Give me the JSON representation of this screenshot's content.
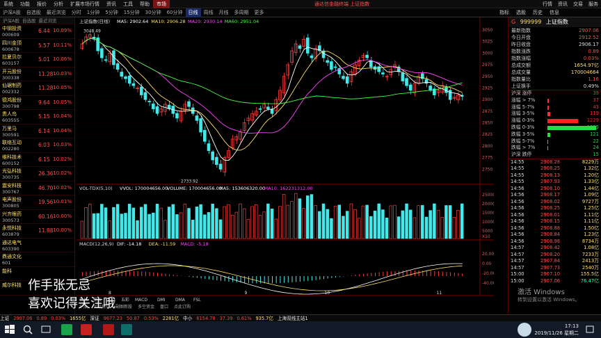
{
  "menu": [
    "系统",
    "功能",
    "报价",
    "分析",
    "扩展市场行情",
    "资讯",
    "工具",
    "帮助"
  ],
  "menu_market": "市场",
  "broker_title": "通达信金融终端  上证指数",
  "top_right": [
    "行情",
    "资讯",
    "交易",
    "服务"
  ],
  "toolbar": [
    "沪深A股",
    "自选股",
    "最近浏览",
    "分时",
    "1分钟",
    "5分钟",
    "15分钟",
    "30分钟",
    "60分钟",
    "日线",
    "周线",
    "月线",
    "多周期",
    "更多"
  ],
  "toolbar_right": [
    "指标",
    "选股",
    "历史",
    "信息"
  ],
  "list_headers": [
    "沪深A股",
    "自选股",
    "最近浏览"
  ],
  "stocks": [
    {
      "name": "中钢投资",
      "code": "000609",
      "price": "6.44",
      "pct": "10.09%"
    },
    {
      "name": "四川金顶",
      "code": "600678",
      "price": "5.57",
      "pct": "10.11%"
    },
    {
      "name": "拉夏贝尔",
      "code": "603157",
      "price": "5.01",
      "pct": "10.06%"
    },
    {
      "name": "开元股份",
      "code": "300338",
      "price": "11.28",
      "pct": "10.03%"
    },
    {
      "name": "仙琚制药",
      "code": "002332",
      "price": "11.28",
      "pct": "10.05%"
    },
    {
      "name": "德鸿股份",
      "code": "300798",
      "price": "9.64",
      "pct": "10.05%"
    },
    {
      "name": "贵人鸟",
      "code": "603555",
      "price": "5.15",
      "pct": "10.04%"
    },
    {
      "name": "万里马",
      "code": "300591",
      "price": "6.14",
      "pct": "10.04%"
    },
    {
      "name": "联络互动",
      "code": "002280",
      "price": "6.03",
      "pct": "10.03%"
    },
    {
      "name": "维科技术",
      "code": "600152",
      "price": "6.15",
      "pct": "10.02%"
    },
    {
      "name": "光弘科技",
      "code": "300735",
      "price": "26.36",
      "pct": "10.02%"
    },
    {
      "name": "震安科技",
      "code": "300767",
      "price": "46.70",
      "pct": "10.02%"
    },
    {
      "name": "电声股份",
      "code": "300805",
      "price": "19.56",
      "pct": "10.01%"
    },
    {
      "name": "兴齐眼药",
      "code": "300573",
      "price": "60.16",
      "pct": "10.00%"
    },
    {
      "name": "永悦科技",
      "code": "603879",
      "price": "11.88",
      "pct": "10.00%"
    },
    {
      "name": "通达电气",
      "code": "603390",
      "price": "",
      "pct": ""
    },
    {
      "name": "鼎通文化",
      "code": "601",
      "price": "",
      "pct": ""
    },
    {
      "name": "能科",
      "code": "",
      "price": "",
      "pct": ""
    },
    {
      "name": "威尔科技",
      "code": "",
      "price": "",
      "pct": ""
    }
  ],
  "chart": {
    "title": "上证指数(日线)",
    "ma_labels": [
      {
        "text": "MA5: 2902.64",
        "color": "#ffffff"
      },
      {
        "text": "MA10: 2906.28",
        "color": "#ffe066"
      },
      {
        "text": "MA20: 2930.14",
        "color": "#ff44ff"
      },
      {
        "text": "MA60: 2951.04",
        "color": "#44ff44"
      }
    ],
    "high_label": "3048.49",
    "low_label": "2733.92",
    "price_axis": [
      "3050",
      "3025",
      "3000",
      "2975",
      "2950",
      "2925",
      "2900",
      "2875",
      "2850",
      "2825",
      "2800",
      "2775",
      "2750"
    ],
    "vol_title": "VOL-TDX(5,10)",
    "vol_labels": [
      {
        "text": "VVOL: 170004656.00",
        "color": "#ffffff"
      },
      {
        "text": "VOLUME: 170004656.00",
        "color": "#ffffff"
      },
      {
        "text": "MA5: 153606320.00",
        "color": "#ffffff"
      },
      {
        "text": "MA10: 162231312.00",
        "color": "#ff44ff"
      }
    ],
    "vol_axis": [
      "25000",
      "20000",
      "15000",
      "10000",
      "5000"
    ],
    "vol_unit": "X10",
    "macd_title": "MACD(12,26,9)",
    "macd_labels": [
      {
        "text": "DIF: -14.18",
        "color": "#ffffff"
      },
      {
        "text": "DEA: -11.59",
        "color": "#ffe066"
      },
      {
        "text": "MACD: -5.18",
        "color": "#ff44ff"
      }
    ],
    "macd_axis": [
      "20.00",
      "0.00",
      "-20.00",
      "-40.00"
    ],
    "date_labels": [
      {
        "text": "8",
        "pos": 0.08
      },
      {
        "text": "9",
        "pos": 0.42
      },
      {
        "text": "10",
        "pos": 0.62
      },
      {
        "text": "11",
        "pos": 0.9
      }
    ],
    "bottom_tabs": [
      "指标",
      "模板",
      "均线",
      "五彩",
      "MACD",
      "DMI",
      "DMA",
      "FSL",
      "TRIX",
      "BRAR",
      "CR",
      "VR",
      "OBV",
      "ASI"
    ],
    "bottom_tabs2": [
      "指标",
      "模板",
      "均线",
      "五彩",
      "MACD",
      "DMI",
      "DMA",
      "FSL"
    ],
    "bottom_tabs3": [
      "扩展",
      "关联报价",
      "副图新股",
      "多空资金",
      "盘口",
      "点此订购"
    ]
  },
  "rpanel": {
    "code": "999999",
    "name": "上证指数",
    "tag": "G",
    "kv": [
      {
        "k": "最新指数",
        "v": "2907.06",
        "c": "red"
      },
      {
        "k": "今日开盘",
        "v": "2912.52",
        "c": "red"
      },
      {
        "k": "昨日收盘",
        "v": "2906.17",
        "c": "w"
      },
      {
        "k": "指数涨跌",
        "v": "0.89",
        "c": "red"
      },
      {
        "k": "指数涨幅",
        "v": "0.03%",
        "c": "red"
      },
      {
        "k": "总成交额",
        "v": "1654.97亿",
        "c": "y"
      },
      {
        "k": "总成交量",
        "v": "170004664",
        "c": "y"
      },
      {
        "k": "指数量比",
        "v": "1.16",
        "c": "red"
      },
      {
        "k": "上证换手",
        "v": "0.49%",
        "c": "w"
      }
    ],
    "dist": [
      {
        "k": "沪深 涨停",
        "v": "39",
        "w": 0,
        "c": "#ff3030"
      },
      {
        "k": "涨幅 > 7%",
        "v": "37",
        "w": 2,
        "c": "#ff3030"
      },
      {
        "k": "涨幅 5-7%",
        "v": "43",
        "w": 2,
        "c": "#ff3030"
      },
      {
        "k": "涨幅 3-5%",
        "v": "119",
        "w": 4,
        "c": "#ff3030"
      },
      {
        "k": "涨幅 0-3%",
        "v": "1229",
        "w": 44,
        "c": "#ff2020"
      },
      {
        "k": "跌幅 0-3%",
        "v": "1895",
        "w": 70,
        "c": "#22dd44"
      },
      {
        "k": "跌幅 3-5%",
        "v": "121",
        "w": 4,
        "c": "#22dd44"
      },
      {
        "k": "跌幅 5-7%",
        "v": "22",
        "w": 1,
        "c": "#22dd44"
      },
      {
        "k": "跌幅 > 7%",
        "v": "24",
        "w": 1,
        "c": "#22dd44"
      },
      {
        "k": "沪深 跌停",
        "v": "15",
        "w": 0,
        "c": "#22dd44"
      }
    ],
    "ticks": [
      {
        "t": "14:55",
        "p": "2908.28",
        "v": "8229万",
        "g": false
      },
      {
        "t": "14:55",
        "p": "2908.25",
        "v": "1.32亿",
        "g": false
      },
      {
        "t": "14:55",
        "p": "2908.13",
        "v": "1.20亿",
        "g": false
      },
      {
        "t": "14:55",
        "p": "2907.93",
        "v": "1.33亿",
        "g": false
      },
      {
        "t": "14:56",
        "p": "2908.10",
        "v": "1.44亿",
        "g": false
      },
      {
        "t": "14:56",
        "p": "2908.17",
        "v": "1.09亿",
        "g": false
      },
      {
        "t": "14:56",
        "p": "2908.02",
        "v": "9727万",
        "g": false
      },
      {
        "t": "14:56",
        "p": "2908.25",
        "v": "1.25亿",
        "g": false
      },
      {
        "t": "14:56",
        "p": "2908.01",
        "v": "1.11亿",
        "g": false
      },
      {
        "t": "14:56",
        "p": "2908.15",
        "v": "1.11亿",
        "g": false
      },
      {
        "t": "14:56",
        "p": "2908.88",
        "v": "1.50亿",
        "g": false
      },
      {
        "t": "14:56",
        "p": "2908.84",
        "v": "1.23亿",
        "g": false
      },
      {
        "t": "14:56",
        "p": "2908.98",
        "v": "8734万",
        "g": false
      },
      {
        "t": "14:57",
        "p": "2908.42",
        "v": "1.08亿",
        "g": false
      },
      {
        "t": "14:57",
        "p": "2908.20",
        "v": "7233万",
        "g": false
      },
      {
        "t": "14:57",
        "p": "2907.84",
        "v": "2413万",
        "g": false
      },
      {
        "t": "14:57",
        "p": "2907.73",
        "v": "2540万",
        "g": false
      },
      {
        "t": "15:00",
        "p": "2907.10",
        "v": "155.5亿",
        "g": false
      },
      {
        "t": "15:00",
        "p": "2907.06",
        "v": "76.47亿",
        "g": true
      }
    ]
  },
  "bottombar": [
    {
      "t": "上证",
      "c": "wht"
    },
    {
      "t": "2907.06",
      "c": "red"
    },
    {
      "t": "0.89",
      "c": "red"
    },
    {
      "t": "0.03%",
      "c": "red"
    },
    {
      "t": "1655亿",
      "c": "ylw"
    },
    {
      "t": "深证",
      "c": "wht"
    },
    {
      "t": "9677.23",
      "c": "red"
    },
    {
      "t": "50.87",
      "c": "red"
    },
    {
      "t": "0.53%",
      "c": "red"
    },
    {
      "t": "2281亿",
      "c": "ylw"
    },
    {
      "t": "中小",
      "c": "wht"
    },
    {
      "t": "6154.78",
      "c": "red"
    },
    {
      "t": "37.39",
      "c": "red"
    },
    {
      "t": "0.61%",
      "c": "red"
    },
    {
      "t": "935.7亿",
      "c": "ylw"
    },
    {
      "t": "上海双线主站1",
      "c": "wht"
    }
  ],
  "overlay": {
    "line1": "作手张无忌",
    "line2": "喜欢记得关注哦"
  },
  "watermark": {
    "line1": "激活 Windows",
    "line2": "转到设置以激活 Windows。"
  },
  "clock": {
    "time": "17:13",
    "date": "2019/11/26 星期二"
  }
}
